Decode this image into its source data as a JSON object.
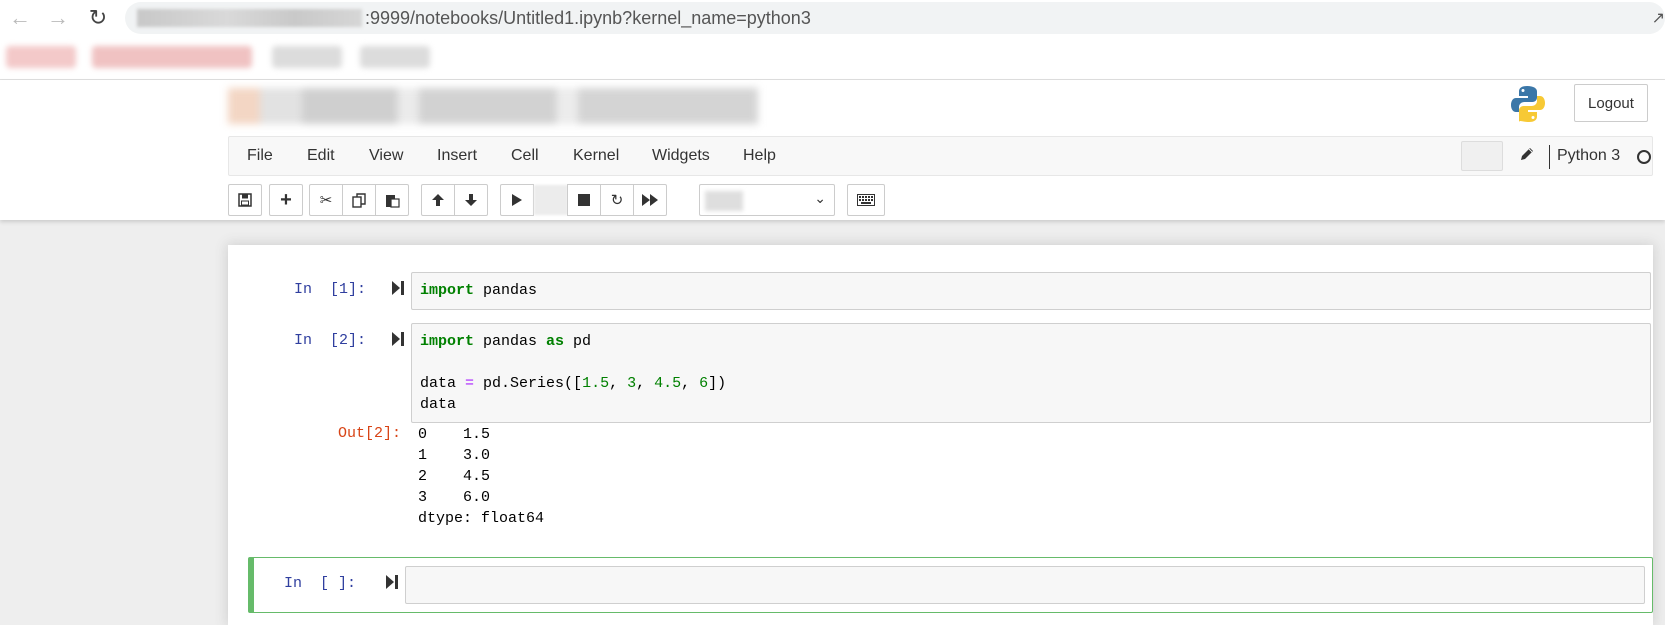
{
  "browser": {
    "url_visible": ":9999/notebooks/Untitled1.ipynb?kernel_name=python3",
    "back_icon": "arrow-left-icon",
    "forward_icon": "arrow-right-icon",
    "reload_icon": "reload-icon"
  },
  "header": {
    "logout_label": "Logout"
  },
  "menu": {
    "items": [
      "File",
      "Edit",
      "View",
      "Insert",
      "Cell",
      "Kernel",
      "Widgets",
      "Help"
    ]
  },
  "kernel": {
    "name": "Python 3"
  },
  "cells": [
    {
      "prompt": "In  [1]:",
      "code": [
        "import pandas"
      ]
    },
    {
      "prompt": "In  [2]:",
      "code": [
        "import pandas as pd",
        "",
        "data = pd.Series([1.5, 3, 4.5, 6])",
        "data"
      ],
      "output_prompt": "Out[2]:",
      "output": [
        "0    1.5",
        "1    3.0",
        "2    4.5",
        "3    6.0",
        "dtype: float64"
      ]
    },
    {
      "prompt": "In  [ ]:",
      "code": []
    }
  ],
  "colors": {
    "prompt_in": "#303f9f",
    "prompt_out": "#d84315",
    "keyword": "#008000",
    "operator": "#aa22ff",
    "selected_border": "#66bb6a"
  }
}
